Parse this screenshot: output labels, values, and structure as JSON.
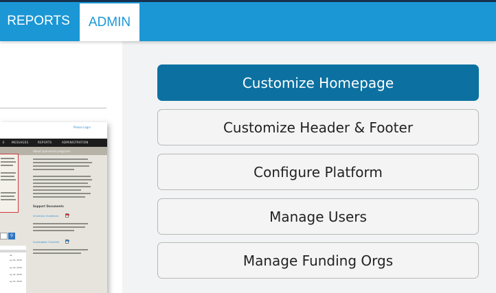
{
  "nav": {
    "items": [
      {
        "label": "REPORTS"
      },
      {
        "label": "ADMIN"
      }
    ],
    "active": "ADMIN"
  },
  "preview": {
    "login_link": "Please Login",
    "nav_items": [
      "E",
      "MESSAGES",
      "REPORTS",
      "ADMINISTRATION"
    ],
    "banner_title": "About sponsored programs",
    "support_heading": "Support Documents",
    "doc_links": [
      "University Guidelines",
      "Investigator Checklist"
    ],
    "table_dates": [
      "ile",
      "ay 14, 2015",
      "ay 14, 2015",
      "ay 14, 2015",
      "ay 15, 2015"
    ]
  },
  "menu": {
    "buttons": [
      {
        "label": "Customize Homepage",
        "active": true
      },
      {
        "label": "Customize Header & Footer",
        "active": false
      },
      {
        "label": "Configure Platform",
        "active": false
      },
      {
        "label": "Manage Users",
        "active": false
      },
      {
        "label": "Manage Funding Orgs",
        "active": false
      }
    ]
  },
  "colors": {
    "navbar": "#1b97d5",
    "active_button": "#0c71a1",
    "button_bg": "#f4f4f4",
    "page_bg": "#f2f3f4"
  }
}
